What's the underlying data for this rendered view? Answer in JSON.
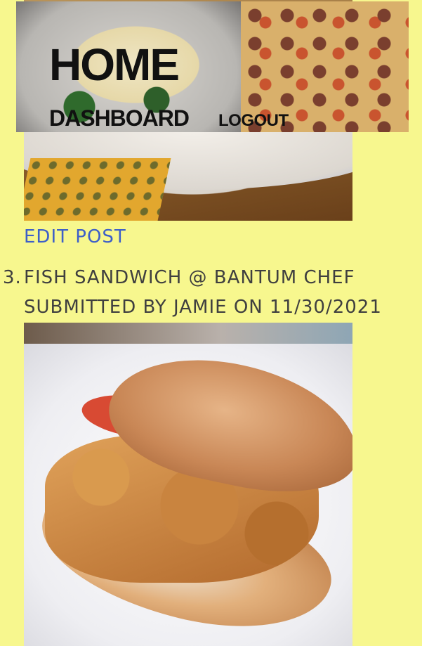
{
  "nav": {
    "title": "HOME",
    "dashboard_label": "DASHBOARD",
    "logout_label": "LOGOUT"
  },
  "previous_post": {
    "edit_label": "EDIT POST"
  },
  "post": {
    "number": "3.",
    "title": "FISH SANDWICH @ BANTUM CHEF",
    "meta": "SUBMITTED BY JAMIE ON 11/30/2021"
  },
  "colors": {
    "page_background": "#f7f78e",
    "link": "#3d5fc8",
    "text": "#3f3f3f"
  }
}
